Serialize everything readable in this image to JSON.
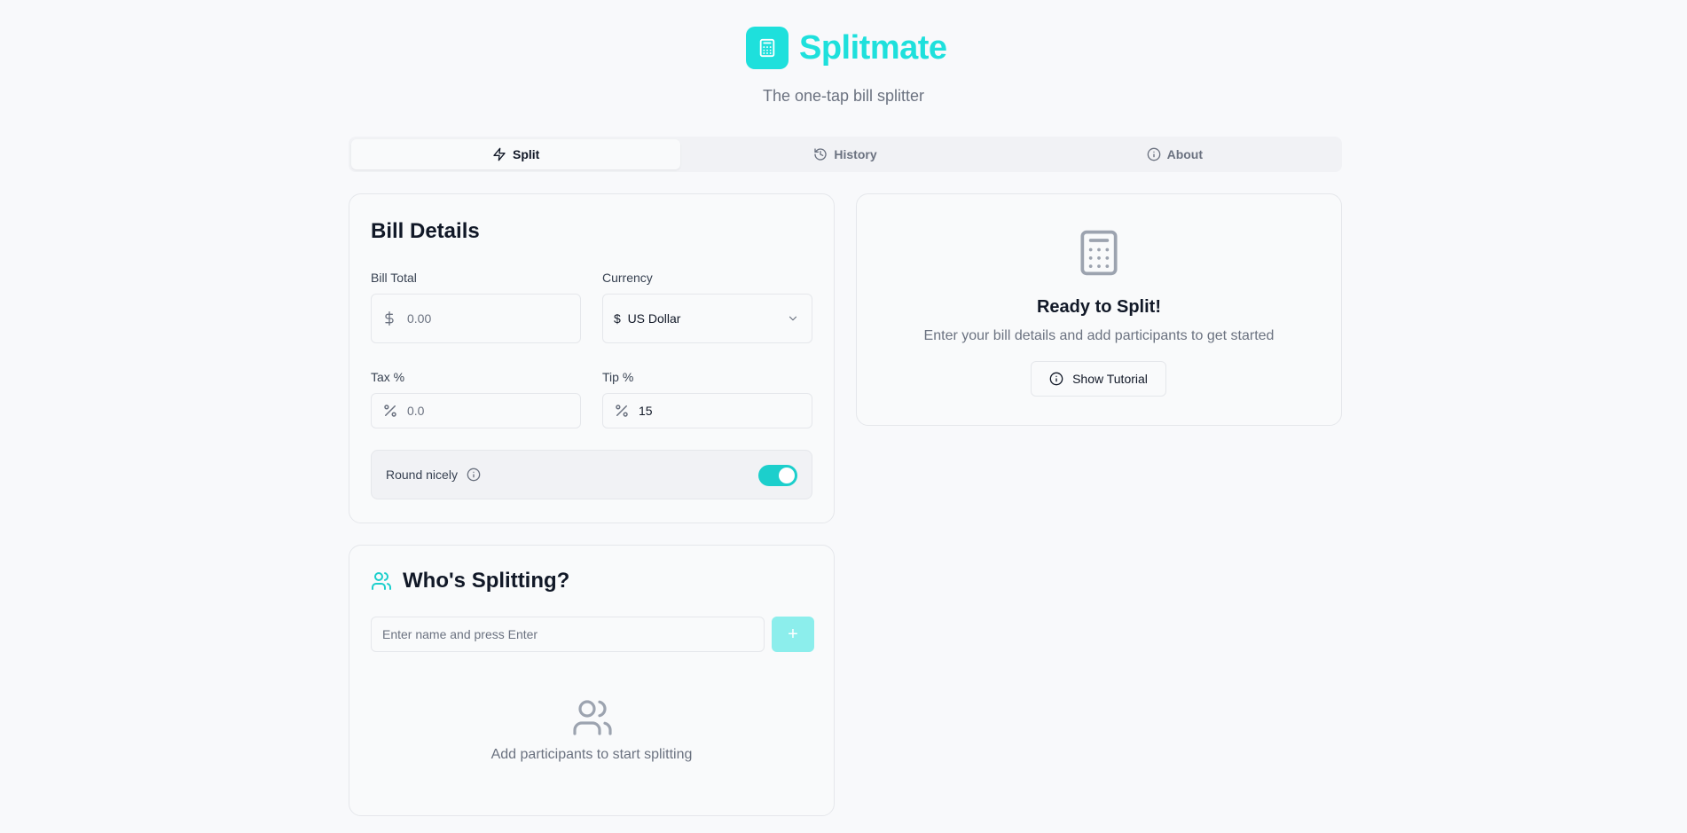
{
  "app": {
    "name": "Splitmate",
    "tagline": "The one-tap bill splitter",
    "brand_color": "#1ee0dc",
    "logo_icon": "calculator-icon"
  },
  "tabs": [
    {
      "label": "Split",
      "icon": "zap-icon",
      "active": true
    },
    {
      "label": "History",
      "icon": "history-icon",
      "active": false
    },
    {
      "label": "About",
      "icon": "info-icon",
      "active": false
    }
  ],
  "bill": {
    "title": "Bill Details",
    "bill_total": {
      "label": "Bill Total",
      "prefix_icon": "dollar-icon",
      "placeholder": "0.00",
      "value": ""
    },
    "currency": {
      "label": "Currency",
      "selected": "$  US Dollar"
    },
    "tax": {
      "label": "Tax %",
      "prefix_icon": "percent-icon",
      "placeholder": "0.0",
      "value": ""
    },
    "tip": {
      "label": "Tip %",
      "prefix_icon": "percent-icon",
      "value": "15"
    },
    "round": {
      "label": "Round nicely",
      "enabled": true
    }
  },
  "participants": {
    "title": "Who's Splitting?",
    "input_placeholder": "Enter name and press Enter",
    "add_label": "+",
    "empty_text": "Add participants to start splitting"
  },
  "ready": {
    "title": "Ready to Split!",
    "subtitle": "Enter your bill details and add participants to get started",
    "tutorial_label": "Show Tutorial"
  }
}
